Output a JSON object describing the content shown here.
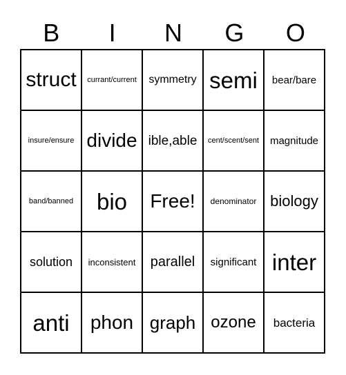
{
  "header": [
    "B",
    "I",
    "N",
    "G",
    "O"
  ],
  "rows": [
    [
      {
        "t": "struct",
        "s": 30
      },
      {
        "t": "currant/current",
        "s": 11
      },
      {
        "t": "symmetry",
        "s": 16
      },
      {
        "t": "semi",
        "s": 33
      },
      {
        "t": "bear/bare",
        "s": 15
      }
    ],
    [
      {
        "t": "insure/ensure",
        "s": 11
      },
      {
        "t": "divide",
        "s": 28
      },
      {
        "t": "ible,able",
        "s": 19
      },
      {
        "t": "cent/scent/sent",
        "s": 11
      },
      {
        "t": "magnitude",
        "s": 15
      }
    ],
    [
      {
        "t": "band/banned",
        "s": 11
      },
      {
        "t": "bio",
        "s": 33
      },
      {
        "t": "Free!",
        "s": 28
      },
      {
        "t": "denominator",
        "s": 12
      },
      {
        "t": "biology",
        "s": 22
      }
    ],
    [
      {
        "t": "solution",
        "s": 18
      },
      {
        "t": "inconsistent",
        "s": 13
      },
      {
        "t": "parallel",
        "s": 20
      },
      {
        "t": "significant",
        "s": 15
      },
      {
        "t": "inter",
        "s": 33
      }
    ],
    [
      {
        "t": "anti",
        "s": 33
      },
      {
        "t": "phon",
        "s": 28
      },
      {
        "t": "graph",
        "s": 26
      },
      {
        "t": "ozone",
        "s": 24
      },
      {
        "t": "bacteria",
        "s": 17
      }
    ]
  ]
}
